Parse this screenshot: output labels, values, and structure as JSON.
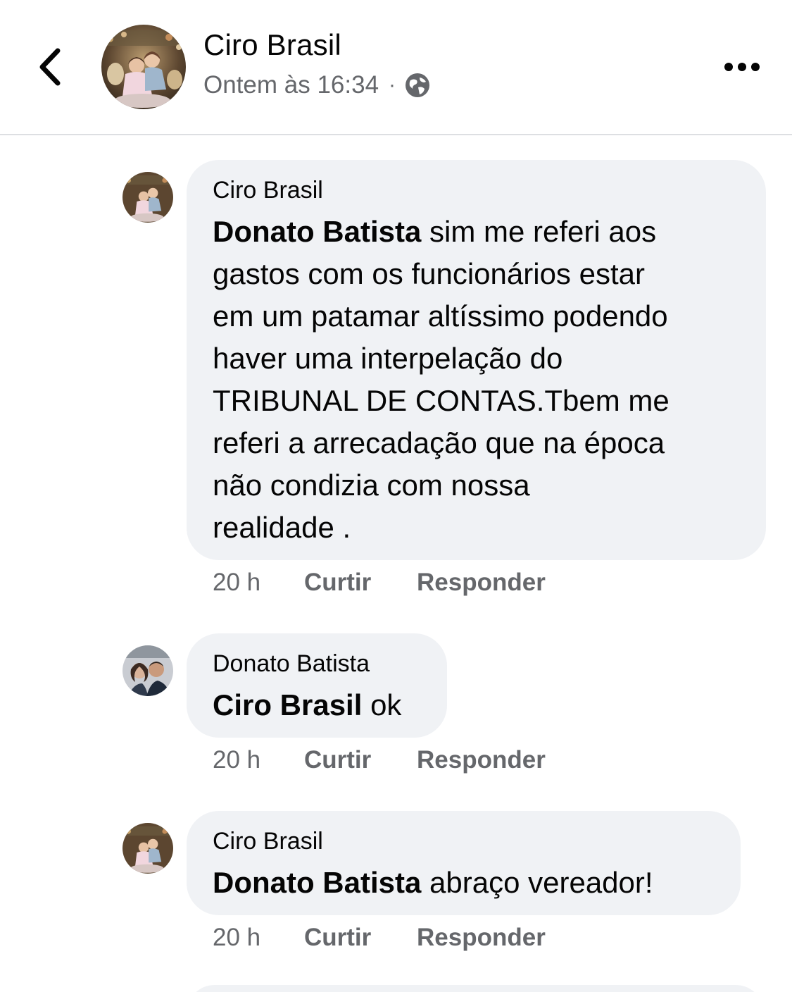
{
  "header": {
    "title": "Ciro Brasil",
    "time": "Ontem às 16:34",
    "separator": "·"
  },
  "comments": [
    {
      "author": "Ciro Brasil",
      "mention": "Donato Batista",
      "lines": [
        " sim me referi aos",
        "gastos com os funcionários estar",
        "em um patamar altíssimo podendo",
        "haver uma interpelação do",
        "TRIBUNAL DE CONTAS.Tbem me",
        "referi a arrecadação que na época",
        "não condizia com nossa",
        "realidade ."
      ],
      "time": "20 h",
      "like": "Curtir",
      "reply": "Responder"
    },
    {
      "author": "Donato Batista",
      "mention": "Ciro Brasil",
      "lines": [
        " ok"
      ],
      "time": "20 h",
      "like": "Curtir",
      "reply": "Responder"
    },
    {
      "author": "Ciro Brasil",
      "mention": "Donato Batista",
      "lines": [
        " abraço vereador!"
      ],
      "time": "20 h",
      "like": "Curtir",
      "reply": "Responder"
    }
  ]
}
